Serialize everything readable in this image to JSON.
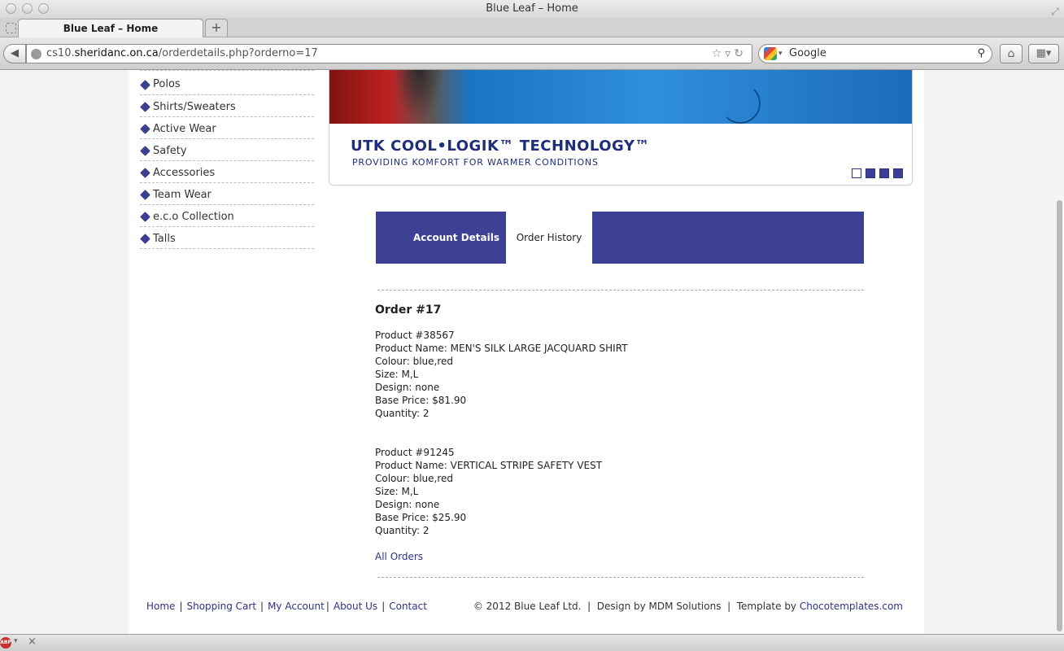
{
  "browser": {
    "window_title": "Blue Leaf – Home",
    "tab_title": "Blue Leaf – Home",
    "new_tab_label": "+",
    "url_prefix": "cs10.",
    "url_domain": "sheridanc.on.ca",
    "url_path": "/orderdetails.php?orderno=17",
    "search_placeholder": "Google",
    "abp_label": "ABP"
  },
  "sidebar": {
    "categories": [
      {
        "label": "Polos"
      },
      {
        "label": "Shirts/Sweaters"
      },
      {
        "label": "Active Wear"
      },
      {
        "label": "Safety"
      },
      {
        "label": "Accessories"
      },
      {
        "label": "Team Wear"
      },
      {
        "label": "e.c.o Collection"
      },
      {
        "label": "Talls"
      }
    ]
  },
  "banner": {
    "headline": "UTK COOL•LOGIK™ TECHNOLOGY™",
    "subline": "PROVIDING KOMFORT FOR WARMER CONDITIONS",
    "slides": 4,
    "active_slide": 1
  },
  "account_tabs": {
    "details": "Account Details",
    "history": "Order History"
  },
  "order": {
    "title": "Order #17",
    "products": [
      {
        "number": "Product #38567",
        "name": "Product Name: MEN'S SILK LARGE JACQUARD SHIRT",
        "colour": "Colour: blue,red",
        "size": "Size: M,L",
        "design": "Design: none",
        "price": "Base Price: $81.90",
        "quantity": "Quantity: 2"
      },
      {
        "number": "Product #91245",
        "name": "Product Name: VERTICAL STRIPE SAFETY VEST",
        "colour": "Colour: blue,red",
        "size": "Size: M,L",
        "design": "Design: none",
        "price": "Base Price: $25.90",
        "quantity": "Quantity: 2"
      }
    ],
    "all_orders_link": "All Orders"
  },
  "footer": {
    "links": [
      "Home",
      "Shopping Cart",
      "My Account",
      "About Us",
      "Contact"
    ],
    "copyright": "© 2012 Blue Leaf Ltd.  |  Design by MDM Solutions  |  Template by ",
    "template_link": "Chocotemplates.com"
  },
  "colors": {
    "brand_blue": "#3d4196",
    "link": "#2d3386"
  }
}
